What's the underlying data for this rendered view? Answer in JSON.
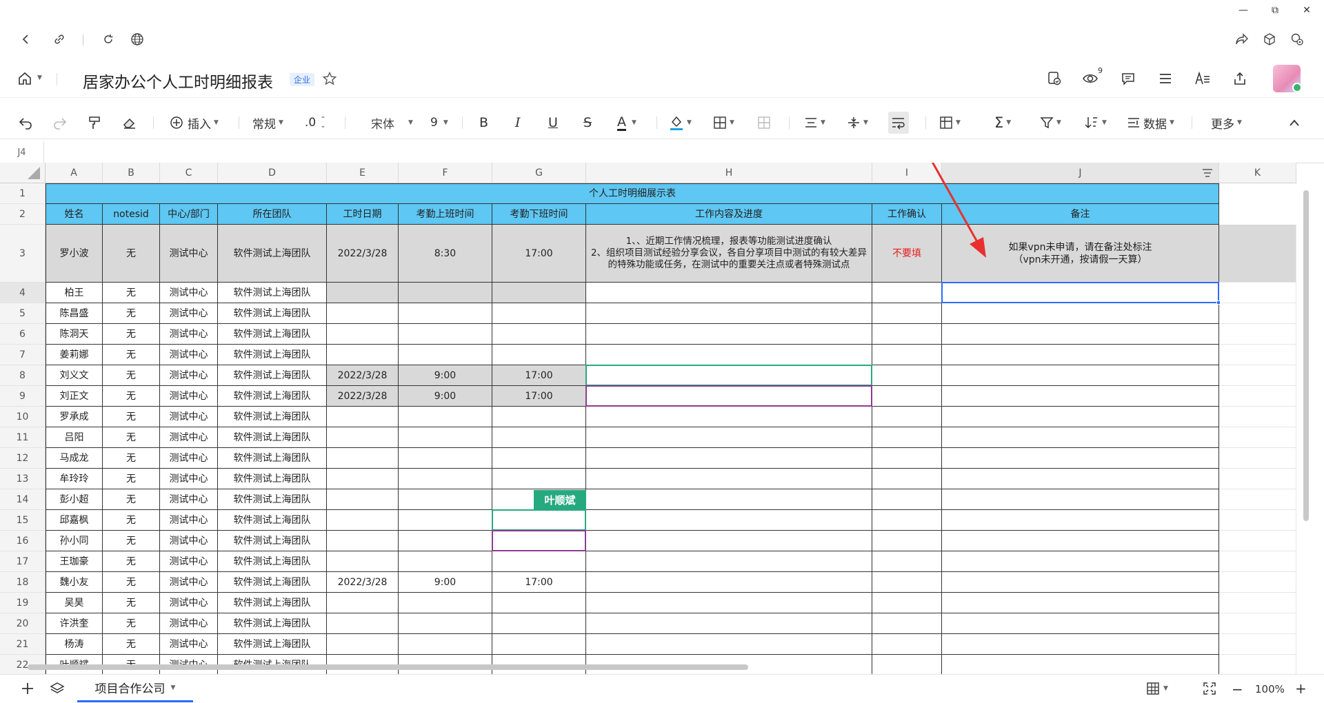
{
  "window": {
    "minimize": "—",
    "restore": "⧉",
    "close": "✕"
  },
  "browser": {
    "back_icon": "back-arrow",
    "link_icon": "link",
    "reload_icon": "reload",
    "globe_icon": "globe"
  },
  "doc": {
    "title": "居家办公个人工时明细报表",
    "badge": "企业",
    "notification_count": "9"
  },
  "toolbar": {
    "insert": "插入",
    "format": "常规",
    "decimal": ".0",
    "font": "宋体",
    "size": "9",
    "bold": "B",
    "italic": "I",
    "underline": "U",
    "strike": "S",
    "fontcolor": "A",
    "data": "数据",
    "more": "更多"
  },
  "formula_bar": {
    "cell_ref": "J4"
  },
  "columns": [
    "A",
    "B",
    "C",
    "D",
    "E",
    "F",
    "G",
    "H",
    "I",
    "J",
    "K"
  ],
  "rows": [
    "1",
    "2",
    "3",
    "4",
    "5",
    "6",
    "7",
    "8",
    "9",
    "10",
    "11",
    "12",
    "13",
    "14",
    "15",
    "16",
    "17",
    "18",
    "19",
    "20",
    "21",
    "22"
  ],
  "sheet": {
    "title": "个人工时明细展示表",
    "headers": [
      "姓名",
      "notesid",
      "中心/部门",
      "所在团队",
      "工时日期",
      "考勤上班时间",
      "考勤下班时间",
      "工作内容及进度",
      "工作确认",
      "备注"
    ],
    "example": {
      "name": "罗小波",
      "notesid": "无",
      "dept": "测试中心",
      "team": "软件测试上海团队",
      "date": "2022/3/28",
      "start": "8:30",
      "end": "17:00",
      "work_line1": "1、、近期工作情况梳理，报表等功能测试进度确认",
      "work_line2": "2、组织项目测试经验分享会议，各自分享项目中测试的有较大差异的特殊功能或任务，在测试中的重要关注点或者特殊测试点",
      "confirm": "不要填",
      "remark_line1": "如果vpn未申请，请在备注处标注",
      "remark_line2": "（vpn未开通，按请假一天算）"
    },
    "people": [
      {
        "name": "柏王",
        "notesid": "无",
        "dept": "测试中心",
        "team": "软件测试上海团队"
      },
      {
        "name": "陈昌盛",
        "notesid": "无",
        "dept": "测试中心",
        "team": "软件测试上海团队"
      },
      {
        "name": "陈洞天",
        "notesid": "无",
        "dept": "测试中心",
        "team": "软件测试上海团队"
      },
      {
        "name": "姜莉娜",
        "notesid": "无",
        "dept": "测试中心",
        "team": "软件测试上海团队"
      },
      {
        "name": "刘义文",
        "notesid": "无",
        "dept": "测试中心",
        "team": "软件测试上海团队",
        "date": "2022/3/28",
        "start": "9:00",
        "end": "17:00"
      },
      {
        "name": "刘正文",
        "notesid": "无",
        "dept": "测试中心",
        "team": "软件测试上海团队",
        "date": "2022/3/28",
        "start": "9:00",
        "end": "17:00"
      },
      {
        "name": "罗承成",
        "notesid": "无",
        "dept": "测试中心",
        "team": "软件测试上海团队"
      },
      {
        "name": "吕阳",
        "notesid": "无",
        "dept": "测试中心",
        "team": "软件测试上海团队"
      },
      {
        "name": "马成龙",
        "notesid": "无",
        "dept": "测试中心",
        "team": "软件测试上海团队"
      },
      {
        "name": "牟玲玲",
        "notesid": "无",
        "dept": "测试中心",
        "team": "软件测试上海团队"
      },
      {
        "name": "彭小超",
        "notesid": "无",
        "dept": "测试中心",
        "team": "软件测试上海团队"
      },
      {
        "name": "邱嘉枫",
        "notesid": "无",
        "dept": "测试中心",
        "team": "软件测试上海团队"
      },
      {
        "name": "孙小同",
        "notesid": "无",
        "dept": "测试中心",
        "team": "软件测试上海团队"
      },
      {
        "name": "王珈豪",
        "notesid": "无",
        "dept": "测试中心",
        "team": "软件测试上海团队"
      },
      {
        "name": "魏小友",
        "notesid": "无",
        "dept": "测试中心",
        "team": "软件测试上海团队",
        "date": "2022/3/28",
        "start": "9:00",
        "end": "17:00"
      },
      {
        "name": "吴昊",
        "notesid": "无",
        "dept": "测试中心",
        "team": "软件测试上海团队"
      },
      {
        "name": "许洪奎",
        "notesid": "无",
        "dept": "测试中心",
        "team": "软件测试上海团队"
      },
      {
        "name": "杨涛",
        "notesid": "无",
        "dept": "测试中心",
        "team": "软件测试上海团队"
      },
      {
        "name": "叶顺斌",
        "notesid": "无",
        "dept": "测试中心",
        "team": "软件测试上海团队"
      }
    ],
    "collab_tag": "叶顺斌"
  },
  "bottom": {
    "sheet_tab": "项目合作公司",
    "zoom": "100%"
  },
  "colors": {
    "header_blue": "#5ec7f3",
    "gray_fill": "#d9d9d9",
    "collab_green": "#27a97f",
    "collab_purple": "#8e3a8e",
    "select_blue": "#2b6bff",
    "arrow_red": "#e8312f",
    "warn_red": "#e81c1c"
  }
}
